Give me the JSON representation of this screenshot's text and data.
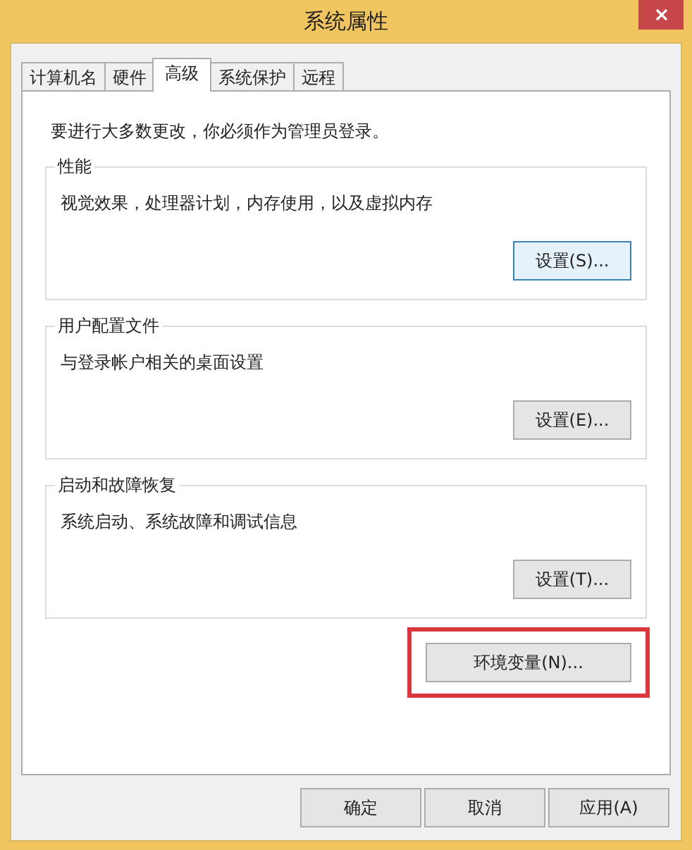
{
  "window": {
    "title": "系统属性"
  },
  "tabs": [
    {
      "label": "计算机名",
      "selected": false
    },
    {
      "label": "硬件",
      "selected": false
    },
    {
      "label": "高级",
      "selected": true
    },
    {
      "label": "系统保护",
      "selected": false
    },
    {
      "label": "远程",
      "selected": false
    }
  ],
  "notice": "要进行大多数更改，你必须作为管理员登录。",
  "groups": [
    {
      "title": "性能",
      "description": "视觉效果，处理器计划，内存使用，以及虚拟内存",
      "button": {
        "label": "设置(S)...",
        "focused": true
      }
    },
    {
      "title": "用户配置文件",
      "description": "与登录帐户相关的桌面设置",
      "button": {
        "label": "设置(E)...",
        "focused": false
      }
    },
    {
      "title": "启动和故障恢复",
      "description": "系统启动、系统故障和调试信息",
      "button": {
        "label": "设置(T)...",
        "focused": false
      }
    }
  ],
  "environment_button": {
    "label": "环境变量(N)...",
    "highlighted": true
  },
  "dialog_buttons": [
    "确定",
    "取消",
    "应用(A)"
  ]
}
